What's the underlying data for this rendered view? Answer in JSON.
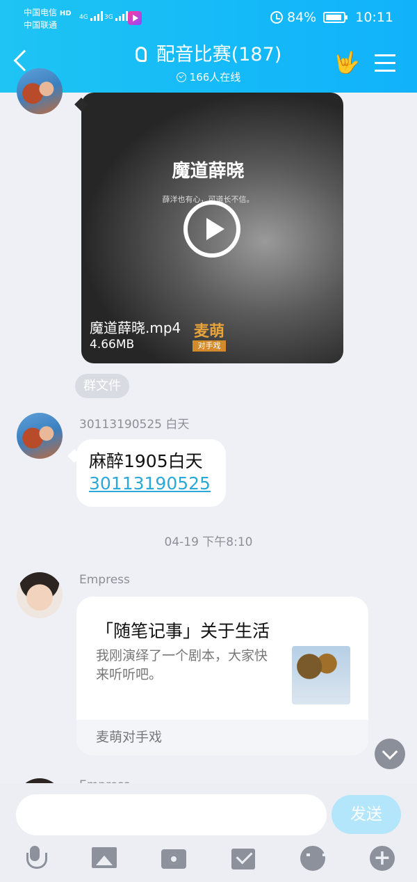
{
  "status_bar": {
    "carrier_1": "中国电信",
    "carrier_1_tag": "HD",
    "carrier_2": "中国联通",
    "net_1": "4G",
    "net_2": "3G",
    "battery": "84%",
    "time": "10:11"
  },
  "header": {
    "title": "配音比赛(187)",
    "online": "166人在线",
    "accent": "#14b9f8"
  },
  "messages": {
    "video": {
      "cover_title": "魔道薛晓",
      "cover_subtitle": "薛洋也有心，可道长不信。",
      "filename": "魔道薛晓.mp4",
      "size": "4.66MB",
      "logo_top": "麦萌",
      "logo_bottom": "对手戏"
    },
    "file_chip": "群文件",
    "text_msg": {
      "sender": "30113190525  白天",
      "line1": "麻醉1905白天",
      "line2": "30113190525"
    },
    "timestamp": "04-19 下午8:10",
    "card_msg": {
      "sender": "Empress",
      "title": "「随笔记事」关于生活",
      "desc": "我刚演绎了一个剧本，大家快来听听吧。",
      "footer": "麦萌对手戏"
    },
    "next_sender": "Empress"
  },
  "input": {
    "placeholder": "",
    "send_label": "发送"
  },
  "toolbar_icons": [
    "microphone-icon",
    "image-icon",
    "camera-icon",
    "envelope-icon",
    "emoji-icon",
    "plus-icon"
  ]
}
